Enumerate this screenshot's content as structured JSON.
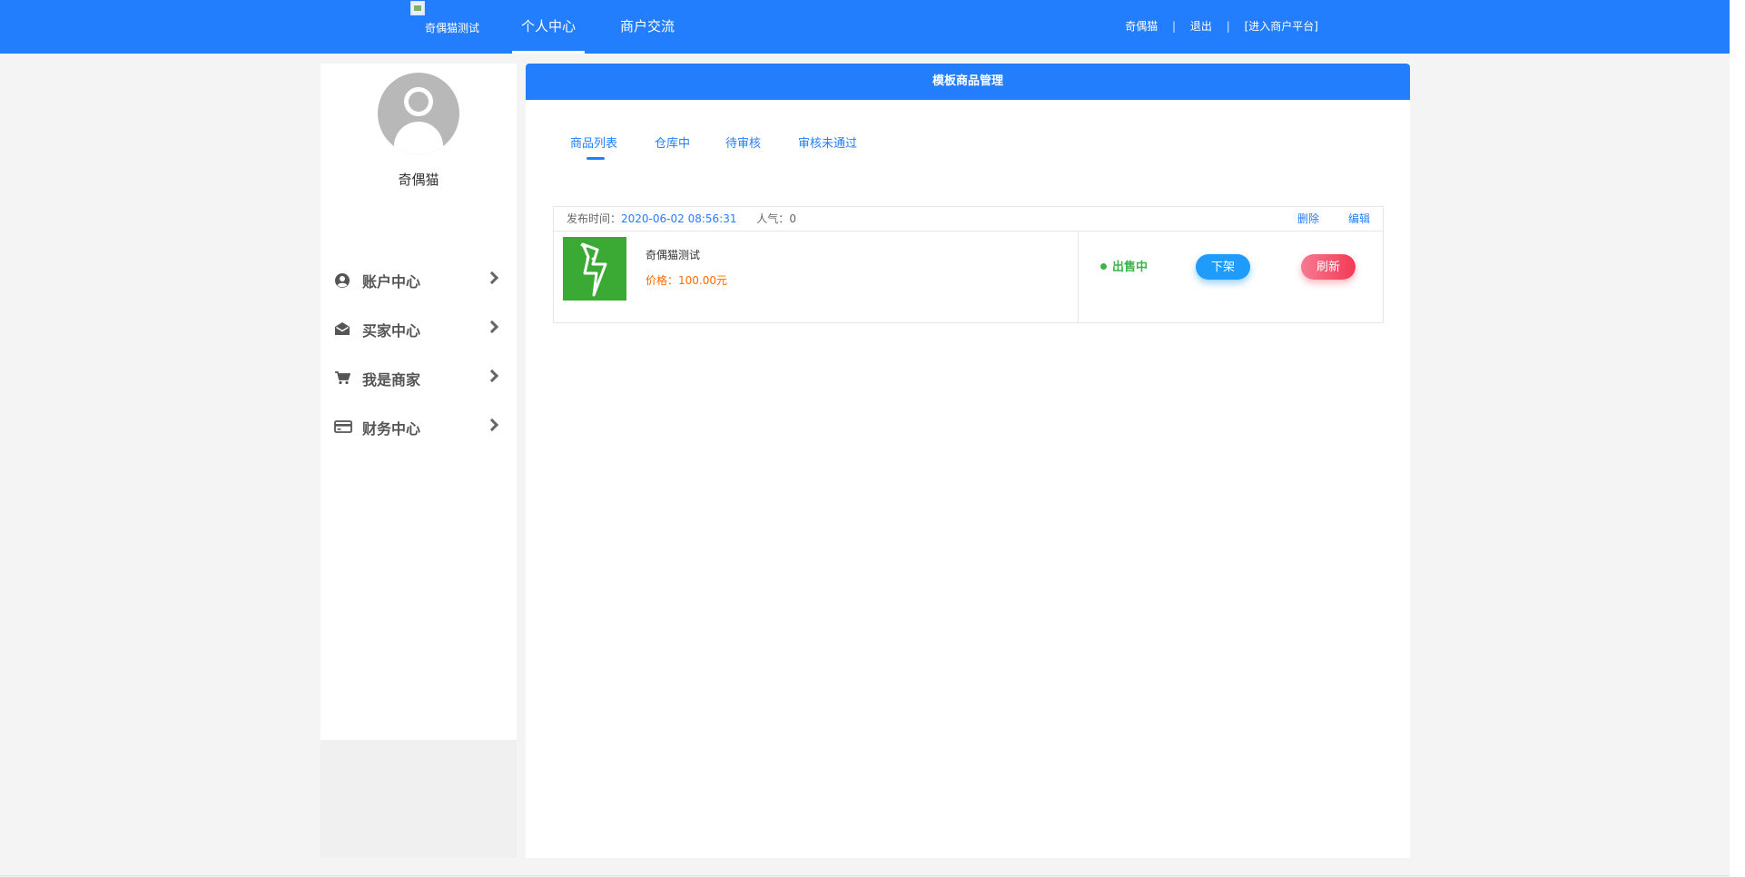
{
  "header": {
    "logo_alt": "奇偶猫测试",
    "nav": [
      {
        "label": "个人中心",
        "active": true
      },
      {
        "label": "商户交流",
        "active": false
      }
    ],
    "user_name": "奇偶猫",
    "logout": "退出",
    "merchant_platform": "[进入商户平台]",
    "separator": "|"
  },
  "sidebar": {
    "username": "奇偶猫",
    "items": [
      {
        "label": "账户中心",
        "icon": "user-circle-icon"
      },
      {
        "label": "买家中心",
        "icon": "envelope-open-icon"
      },
      {
        "label": "我是商家",
        "icon": "cart-icon"
      },
      {
        "label": "财务中心",
        "icon": "credit-card-icon"
      }
    ]
  },
  "main": {
    "title": "模板商品管理",
    "tabs": [
      {
        "label": "商品列表",
        "active": true
      },
      {
        "label": "仓库中",
        "active": false
      },
      {
        "label": "待审核",
        "active": false
      },
      {
        "label": "审核未通过",
        "active": false
      }
    ],
    "product": {
      "publish_label": "发布时间：",
      "publish_time": "2020-06-02 08:56:31",
      "popularity_label": "人气：",
      "popularity": "0",
      "delete": "删除",
      "edit": "编辑",
      "name": "奇偶猫测试",
      "price_label": "价格：",
      "price": "100.00元",
      "status": "出售中",
      "off_shelf": "下架",
      "refresh": "刷新"
    }
  },
  "colors": {
    "primary": "#237efe",
    "status_green": "#39b54a",
    "price_orange": "#ff6a00",
    "off_button": "#1e9bfb",
    "refresh_button": "#f23a54",
    "thumb_green": "#3aaa35"
  }
}
